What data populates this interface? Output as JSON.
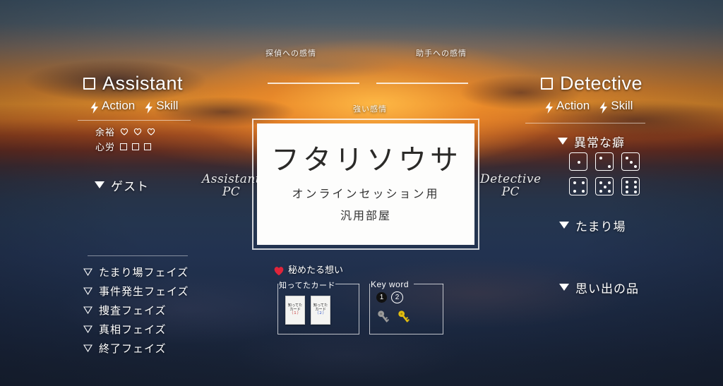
{
  "background": {
    "description": "sunset-over-sea photograph",
    "sky_top": "#42596b",
    "sun_glow": "#ffba46",
    "sea_bottom": "#182234"
  },
  "center_card": {
    "title": "フタリソウサ",
    "subtitle_1": "オンラインセッション用",
    "subtitle_2": "汎用部屋"
  },
  "emotions": {
    "left_label": "探偵への感情",
    "right_label": "助手への感情",
    "center_label": "強い感情"
  },
  "pc_labels": {
    "left_line1": "Assistant",
    "left_line2": "PC",
    "right_line1": "Detective",
    "right_line2": "PC"
  },
  "assistant": {
    "title": "Assistant",
    "action_label": "Action",
    "skill_label": "Skill",
    "bolt_icon": "lightning-bolt-icon",
    "checkbox_icon": "empty-square-icon",
    "stats": [
      {
        "label": "余裕",
        "icon": "heart-outline-icon",
        "count": 3
      },
      {
        "label": "心労",
        "icon": "square-outline-icon",
        "count": 3
      }
    ],
    "guest_label": "ゲスト",
    "phases": [
      "たまり場フェイズ",
      "事件発生フェイズ",
      "捜査フェイズ",
      "真相フェイズ",
      "終了フェイズ"
    ]
  },
  "detective": {
    "title": "Detective",
    "action_label": "Action",
    "skill_label": "Skill",
    "bolt_icon": "lightning-bolt-icon",
    "checkbox_icon": "empty-square-icon",
    "quirk_label": "異常な癖",
    "dice": [
      1,
      2,
      3,
      4,
      5,
      6
    ],
    "hangout_label": "たまり場",
    "memento_label": "思い出の品"
  },
  "secret_feeling": {
    "icon": "heart-filled-icon",
    "label": "秘めたる想い"
  },
  "known_cards": {
    "group_label": "知ってたカード",
    "cards": [
      {
        "line1": "知ってた",
        "line2": "カード",
        "line3": "（１）",
        "accent": "#c02020"
      },
      {
        "line1": "知ってた",
        "line2": "カード",
        "line3": "（２）",
        "accent": "#2a50c8"
      }
    ]
  },
  "key_word": {
    "group_label": "Key word",
    "markers": [
      {
        "text": "❶",
        "style": "filled"
      },
      {
        "text": "②",
        "style": "open"
      }
    ],
    "keys": [
      {
        "icon": "key-icon",
        "color": "#9a9a9a"
      },
      {
        "icon": "key-icon",
        "color": "#e0bc10"
      }
    ]
  }
}
